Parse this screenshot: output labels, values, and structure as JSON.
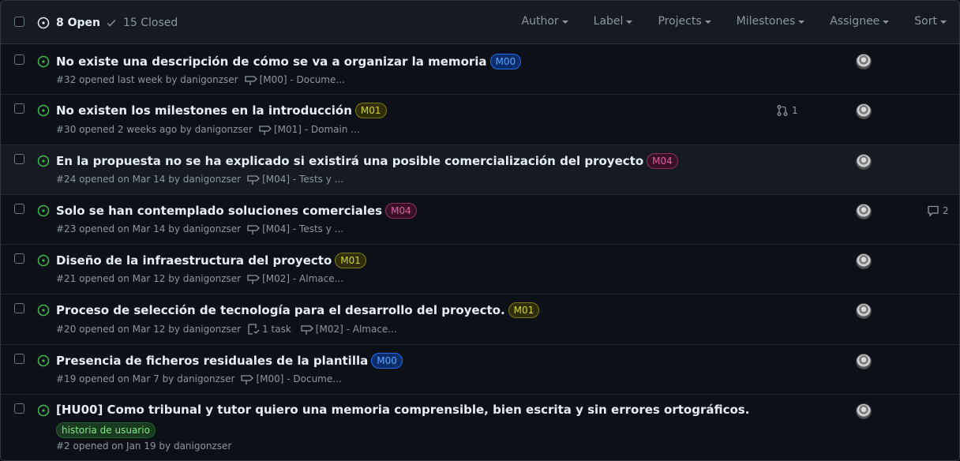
{
  "header": {
    "open_label": "8 Open",
    "closed_label": "15 Closed",
    "filters": [
      "Author",
      "Label",
      "Projects",
      "Milestones",
      "Assignee",
      "Sort"
    ]
  },
  "issues": [
    {
      "title": "No existe una descripción de cómo se va a organizar la memoria",
      "label": "M00",
      "meta": "#32 opened last week by danigonzser",
      "milestone": "[M00] - Docume..."
    },
    {
      "title": "No existen los milestones en la introducción",
      "label": "M01",
      "meta": "#30 opened 2 weeks ago by danigonzser",
      "milestone": "[M01] - Domain ...",
      "pr_count": "1"
    },
    {
      "title": "En la propuesta no se ha explicado si existirá una posible comercialización del proyecto",
      "label": "M04",
      "meta": "#24 opened on Mar 14 by danigonzser",
      "milestone": "[M04] - Tests y ..."
    },
    {
      "title": "Solo se han contemplado soluciones comerciales",
      "label": "M04",
      "meta": "#23 opened on Mar 14 by danigonzser",
      "milestone": "[M04] - Tests y ...",
      "comment_count": "2"
    },
    {
      "title": "Diseño de la infraestructura del proyecto",
      "label": "M01",
      "meta": "#21 opened on Mar 12 by danigonzser",
      "milestone": "[M02] - Almace..."
    },
    {
      "title": "Proceso de selección de tecnología para el desarrollo del proyecto.",
      "label": "M01",
      "meta": "#20 opened on Mar 12 by danigonzser",
      "tasks": "1 task",
      "milestone": "[M02] - Almace..."
    },
    {
      "title": "Presencia de ficheros residuales de la plantilla",
      "label": "M00",
      "meta": "#19 opened on Mar 7 by danigonzser",
      "milestone": "[M00] - Docume..."
    },
    {
      "title": "[HU00] Como tribunal y tutor quiero una memoria comprensible, bien escrita y sin errores ortográficos.",
      "label": "historia de usuario",
      "meta": "#2 opened on Jan 19 by danigonzser"
    }
  ],
  "colors": {
    "M00": "#58a6ff",
    "M01": "#d2d22a",
    "M04": "#db61a2",
    "open_icon": "#3fb950"
  }
}
